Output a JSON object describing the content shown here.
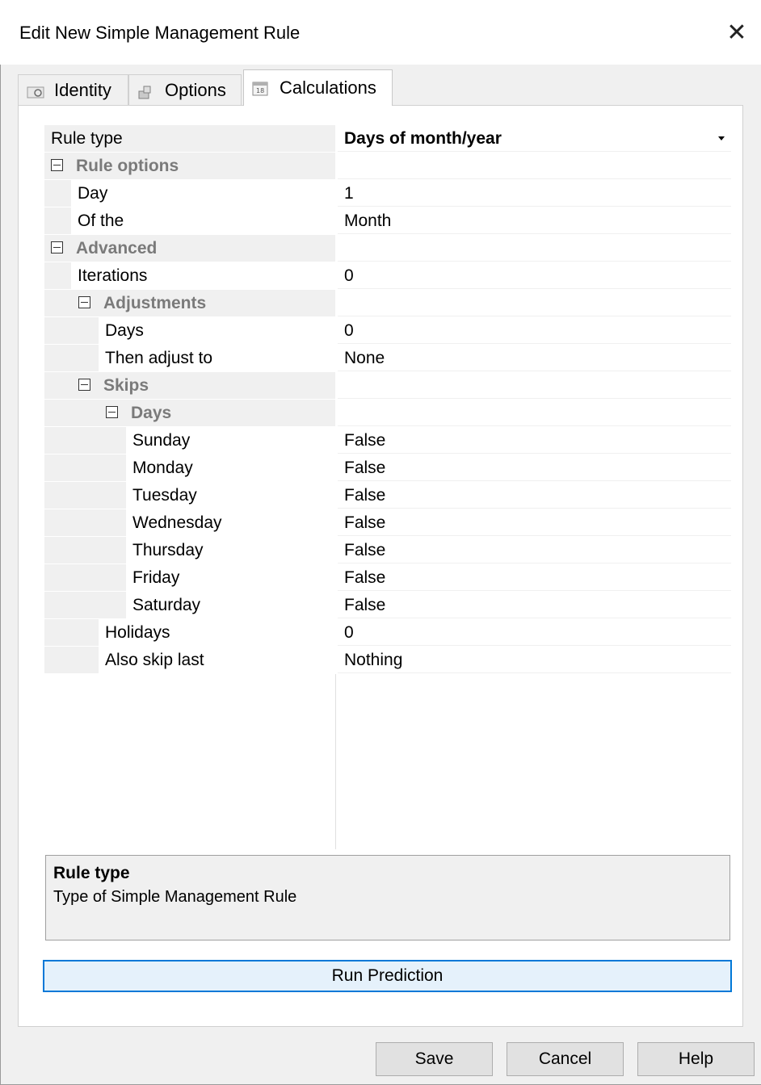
{
  "window": {
    "title": "Edit New Simple Management Rule",
    "close_glyph": "✕"
  },
  "tabs": [
    {
      "label": "Identity",
      "icon": "identity-icon"
    },
    {
      "label": "Options",
      "icon": "options-icon"
    },
    {
      "label": "Calculations",
      "icon": "calendar-icon",
      "active": true
    }
  ],
  "grid": {
    "rows": [
      {
        "kind": "prop",
        "label": "Rule type",
        "value": "Days of month/year",
        "bold_value": true,
        "has_dropdown": true
      },
      {
        "kind": "cat",
        "label": "Rule options",
        "expanded": true
      },
      {
        "kind": "prop",
        "label": "Day",
        "value": "1"
      },
      {
        "kind": "prop",
        "label": "Of the",
        "value": "Month"
      },
      {
        "kind": "cat",
        "label": "Advanced",
        "expanded": true
      },
      {
        "kind": "prop",
        "label": "Iterations",
        "value": "0"
      },
      {
        "kind": "cat",
        "label": "Adjustments",
        "expanded": true
      },
      {
        "kind": "prop",
        "label": "Days",
        "value": "0"
      },
      {
        "kind": "prop",
        "label": "Then adjust to",
        "value": "None"
      },
      {
        "kind": "cat",
        "label": "Skips",
        "expanded": true
      },
      {
        "kind": "cat",
        "label": "Days",
        "expanded": true
      },
      {
        "kind": "prop",
        "label": "Sunday",
        "value": "False"
      },
      {
        "kind": "prop",
        "label": "Monday",
        "value": "False"
      },
      {
        "kind": "prop",
        "label": "Tuesday",
        "value": "False"
      },
      {
        "kind": "prop",
        "label": "Wednesday",
        "value": "False"
      },
      {
        "kind": "prop",
        "label": "Thursday",
        "value": "False"
      },
      {
        "kind": "prop",
        "label": "Friday",
        "value": "False"
      },
      {
        "kind": "prop",
        "label": "Saturday",
        "value": "False"
      },
      {
        "kind": "prop",
        "label": "Holidays",
        "value": "0"
      },
      {
        "kind": "prop",
        "label": "Also skip last",
        "value": "Nothing"
      }
    ]
  },
  "description": {
    "title": "Rule type",
    "text": "Type of Simple Management Rule"
  },
  "buttons": {
    "run_prediction": "Run Prediction",
    "save": "Save",
    "cancel": "Cancel",
    "help": "Help"
  }
}
